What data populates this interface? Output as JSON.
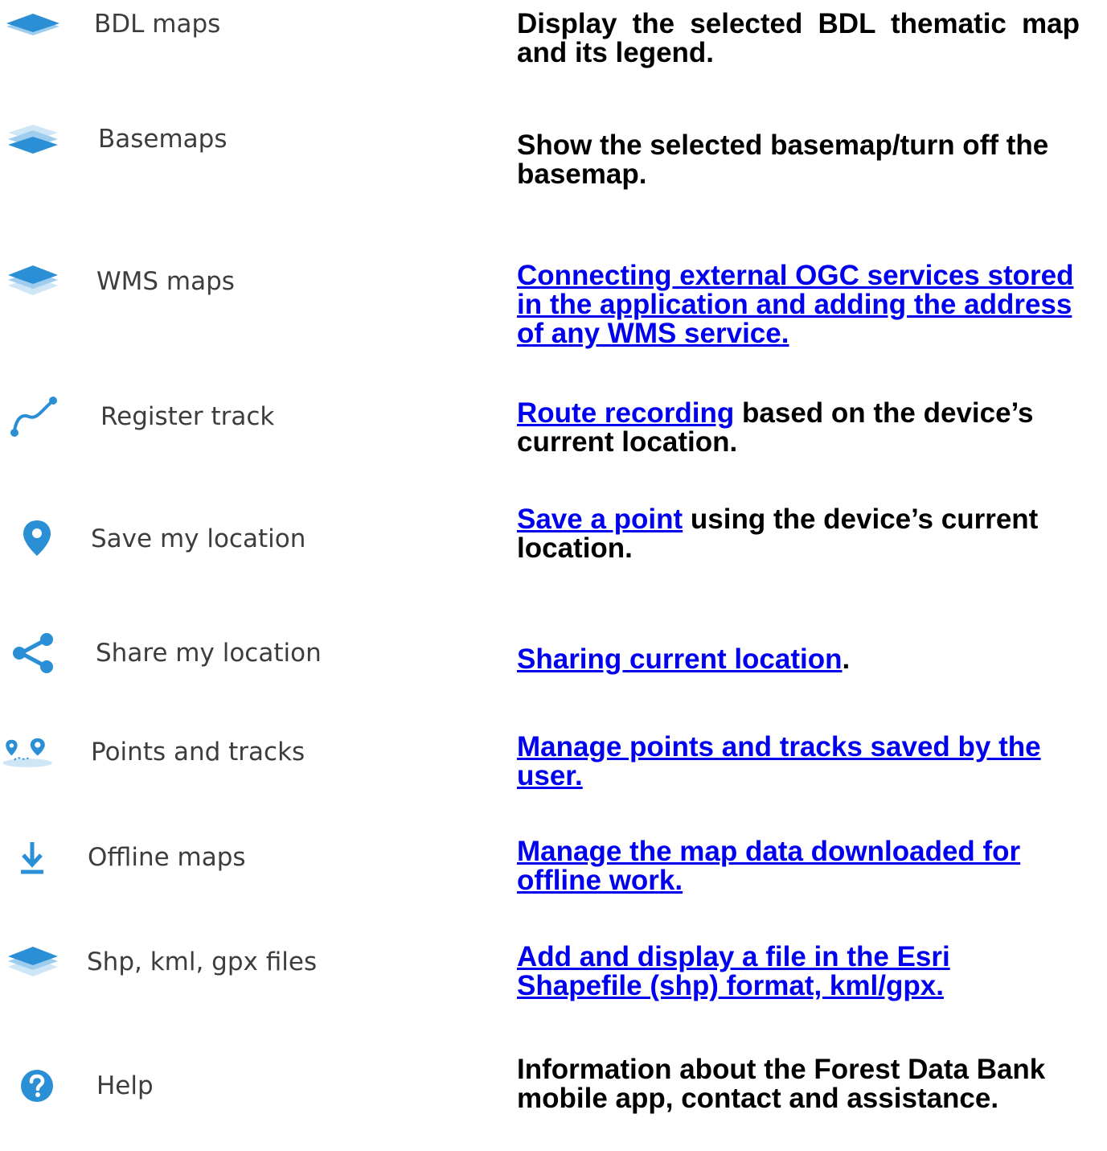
{
  "colors": {
    "icon_blue": "#2b8fd6",
    "icon_light": "#9fcdee",
    "link": "#0000ee",
    "label": "#3d3d3d"
  },
  "items": [
    {
      "icon": "layers-icon",
      "label": "BDL maps",
      "desc_pre": "",
      "desc_link": "",
      "desc_post": "Display the selected BDL thematic map and its legend."
    },
    {
      "icon": "basemap-layers-icon",
      "label": "Basemaps",
      "desc_pre": "",
      "desc_link": "",
      "desc_post": "Show the selected basemap/turn off the basemap."
    },
    {
      "icon": "wms-layers-icon",
      "label": "WMS maps",
      "desc_pre": "",
      "desc_link": "Connecting external OGC services stored in the application and adding the address of any WMS service.",
      "desc_post": ""
    },
    {
      "icon": "track-icon",
      "label": "Register track",
      "desc_pre": "",
      "desc_link": "Route recording",
      "desc_post": " based on the device’s current location."
    },
    {
      "icon": "location-pin-icon",
      "label": "Save my location",
      "desc_pre": "",
      "desc_link": "Save a point",
      "desc_post": " using the device’s current location."
    },
    {
      "icon": "share-icon",
      "label": "Share my location",
      "desc_pre": "",
      "desc_link": "Sharing current location",
      "desc_post": "."
    },
    {
      "icon": "points-tracks-icon",
      "label": "Points and tracks",
      "desc_pre": "",
      "desc_link": "Manage points and tracks saved by the user.",
      "desc_post": ""
    },
    {
      "icon": "download-icon",
      "label": "Offline maps",
      "desc_pre": "",
      "desc_link": "Manage the map data downloaded for offline work.",
      "desc_post": ""
    },
    {
      "icon": "file-layers-icon",
      "label": "Shp, kml, gpx files",
      "desc_pre": "",
      "desc_link": "Add and display a file in the Esri Shapefile (shp) format, kml/gpx.",
      "desc_post": ""
    },
    {
      "icon": "help-icon",
      "label": "Help",
      "desc_pre": "",
      "desc_link": "",
      "desc_post": "Information about the Forest Data Bank mobile app, contact and assistance."
    }
  ]
}
